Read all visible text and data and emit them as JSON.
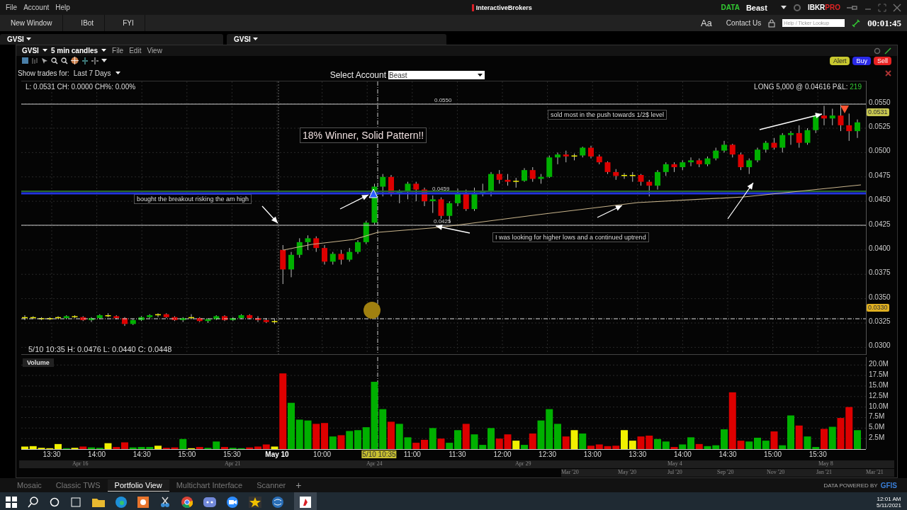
{
  "menu_bar": {
    "items": [
      "File",
      "Account",
      "Help"
    ],
    "logo": "InteractiveBrokers",
    "data_label": "DATA",
    "account": "Beast",
    "brand": "IBKR",
    "brand_suffix": "PRO"
  },
  "toolbar": {
    "buttons": [
      "New Window",
      "IBot",
      "FYI"
    ],
    "font_button": "Aa",
    "contact": "Contact Us",
    "search": {
      "placeholder": "Help / Ticker Lookup"
    },
    "clock": "00:01:45"
  },
  "panels": [
    {
      "title": "GVSI"
    },
    {
      "title": "GVSI"
    }
  ],
  "chart_window": {
    "symbol": "GVSI",
    "interval": "5 min candles",
    "menus": [
      "File",
      "Edit",
      "View"
    ],
    "trades_label": "Show trades for:",
    "trades_period": "Last 7 Days",
    "account_label": "Select Account",
    "account_value": "Beast",
    "order_buttons": [
      {
        "label": "Alert",
        "kind": "alert"
      },
      {
        "label": "Buy",
        "kind": "buy"
      },
      {
        "label": "Sell",
        "kind": "sell"
      }
    ],
    "stats": "L: 0.0531 CH: 0.0000 CH%: 0.00%",
    "position": "LONG 5,000 @ 0.04616 P&L:",
    "pnl": "219",
    "price_tags": [
      {
        "text": "0.0531",
        "kind": "last"
      },
      {
        "text": "0.0330",
        "kind": "cursor"
      }
    ],
    "line_labels": [
      "0.0550",
      "0.0459",
      "0.0425"
    ],
    "annotations": [
      {
        "text": "18% Winner, Solid Pattern!!",
        "kind": "headline"
      },
      {
        "text": "sold most in the push towards 1/2$ level",
        "kind": "note"
      },
      {
        "text": "bought the breakout risking the am high",
        "kind": "note"
      },
      {
        "text": "I was looking for higher lows and a continued uptrend",
        "kind": "note"
      }
    ],
    "hover": "5/10 10:35 H: 0.0476 L: 0.0440 C: 0.0448",
    "chart_data": {
      "type": "candlestick",
      "ylim": [
        0.0293,
        0.0573
      ],
      "grid": true,
      "yticks": [
        {
          "value": 0.055,
          "label": "0.0550"
        },
        {
          "value": 0.0525,
          "label": "0.0525"
        },
        {
          "value": 0.05,
          "label": "0.0500"
        },
        {
          "value": 0.0475,
          "label": "0.0475"
        },
        {
          "value": 0.045,
          "label": "0.0450"
        },
        {
          "value": 0.0425,
          "label": "0.0425"
        },
        {
          "value": 0.04,
          "label": "0.0400"
        },
        {
          "value": 0.0375,
          "label": "0.0375"
        },
        {
          "value": 0.035,
          "label": "0.0350"
        },
        {
          "value": 0.0325,
          "label": "0.0325"
        },
        {
          "value": 0.03,
          "label": "0.0300"
        }
      ],
      "ohlc": [
        [
          0.033,
          0.0333,
          0.0328,
          0.0331
        ],
        [
          0.0331,
          0.0332,
          0.0329,
          0.033
        ],
        [
          0.033,
          0.0331,
          0.0328,
          0.0329
        ],
        [
          0.0329,
          0.0331,
          0.0328,
          0.033
        ],
        [
          0.033,
          0.0332,
          0.0329,
          0.0331
        ],
        [
          0.033,
          0.0333,
          0.0329,
          0.0332
        ],
        [
          0.0332,
          0.0333,
          0.033,
          0.0331
        ],
        [
          0.0331,
          0.0332,
          0.0327,
          0.0328
        ],
        [
          0.0328,
          0.0331,
          0.0326,
          0.033
        ],
        [
          0.033,
          0.0334,
          0.0329,
          0.0333
        ],
        [
          0.0333,
          0.0335,
          0.0331,
          0.0332
        ],
        [
          0.0332,
          0.0333,
          0.0329,
          0.033
        ],
        [
          0.033,
          0.0331,
          0.0322,
          0.0324
        ],
        [
          0.0324,
          0.0329,
          0.0323,
          0.0328
        ],
        [
          0.0328,
          0.0332,
          0.0327,
          0.0331
        ],
        [
          0.0331,
          0.0334,
          0.033,
          0.0333
        ],
        [
          0.0333,
          0.0335,
          0.0331,
          0.0334
        ],
        [
          0.0334,
          0.0335,
          0.033,
          0.0331
        ],
        [
          0.0331,
          0.0332,
          0.0327,
          0.0328
        ],
        [
          0.0328,
          0.0331,
          0.0326,
          0.033
        ],
        [
          0.033,
          0.0334,
          0.0329,
          0.0331
        ],
        [
          0.033,
          0.0331,
          0.0326,
          0.0327
        ],
        [
          0.0327,
          0.033,
          0.0325,
          0.0329
        ],
        [
          0.0329,
          0.0333,
          0.0328,
          0.0332
        ],
        [
          0.0332,
          0.0333,
          0.0327,
          0.0328
        ],
        [
          0.0328,
          0.0331,
          0.0327,
          0.033
        ],
        [
          0.033,
          0.0334,
          0.0329,
          0.0333
        ],
        [
          0.0333,
          0.0334,
          0.0329,
          0.033
        ],
        [
          0.033,
          0.0332,
          0.0326,
          0.0328
        ],
        [
          0.0328,
          0.033,
          0.0325,
          0.0326
        ],
        [
          0.0326,
          0.0329,
          0.0324,
          0.0327
        ],
        [
          0.04,
          0.0405,
          0.0365,
          0.038
        ],
        [
          0.038,
          0.0398,
          0.0372,
          0.0395
        ],
        [
          0.0395,
          0.0412,
          0.0392,
          0.0408
        ],
        [
          0.0408,
          0.0415,
          0.04,
          0.0412
        ],
        [
          0.0412,
          0.0414,
          0.0398,
          0.0402
        ],
        [
          0.0402,
          0.0405,
          0.0385,
          0.0388
        ],
        [
          0.0388,
          0.0398,
          0.0385,
          0.0396
        ],
        [
          0.0396,
          0.04,
          0.0385,
          0.039
        ],
        [
          0.039,
          0.0402,
          0.0388,
          0.0398
        ],
        [
          0.0398,
          0.041,
          0.0396,
          0.0408
        ],
        [
          0.0408,
          0.043,
          0.0406,
          0.0428
        ],
        [
          0.0428,
          0.0468,
          0.0426,
          0.0465
        ],
        [
          0.0465,
          0.0478,
          0.0455,
          0.0475
        ],
        [
          0.0475,
          0.0477,
          0.0455,
          0.0458
        ],
        [
          0.0458,
          0.0462,
          0.0448,
          0.046
        ],
        [
          0.046,
          0.047,
          0.0452,
          0.0468
        ],
        [
          0.0468,
          0.047,
          0.045,
          0.0462
        ],
        [
          0.0462,
          0.0464,
          0.0445,
          0.045
        ],
        [
          0.045,
          0.0456,
          0.0438,
          0.0452
        ],
        [
          0.0452,
          0.0454,
          0.0432,
          0.0435
        ],
        [
          0.0435,
          0.045,
          0.0428,
          0.0448
        ],
        [
          0.0448,
          0.0463,
          0.0445,
          0.0458
        ],
        [
          0.0458,
          0.0462,
          0.044,
          0.0442
        ],
        [
          0.0442,
          0.0464,
          0.044,
          0.0458
        ],
        [
          0.0458,
          0.0468,
          0.0455,
          0.046
        ],
        [
          0.046,
          0.048,
          0.0455,
          0.0478
        ],
        [
          0.0478,
          0.0482,
          0.0468,
          0.0472
        ],
        [
          0.0472,
          0.0478,
          0.0466,
          0.047
        ],
        [
          0.047,
          0.0474,
          0.0464,
          0.0471
        ],
        [
          0.0471,
          0.0484,
          0.047,
          0.0482
        ],
        [
          0.0482,
          0.0485,
          0.047,
          0.0473
        ],
        [
          0.0473,
          0.0478,
          0.0468,
          0.0475
        ],
        [
          0.0475,
          0.0497,
          0.0474,
          0.0495
        ],
        [
          0.0495,
          0.05,
          0.0488,
          0.0498
        ],
        [
          0.0498,
          0.0502,
          0.049,
          0.0496
        ],
        [
          0.0496,
          0.0499,
          0.0492,
          0.0497
        ],
        [
          0.0497,
          0.0506,
          0.0495,
          0.0505
        ],
        [
          0.0505,
          0.0507,
          0.0494,
          0.0496
        ],
        [
          0.0496,
          0.0498,
          0.0488,
          0.049
        ],
        [
          0.049,
          0.0491,
          0.0478,
          0.048
        ],
        [
          0.048,
          0.0483,
          0.0472,
          0.0476
        ],
        [
          0.0476,
          0.0479,
          0.0473,
          0.0477
        ],
        [
          0.0476,
          0.048,
          0.047,
          0.0477
        ],
        [
          0.0477,
          0.0478,
          0.0466,
          0.047
        ],
        [
          0.047,
          0.0472,
          0.0455,
          0.0466
        ],
        [
          0.0466,
          0.0482,
          0.0462,
          0.048
        ],
        [
          0.048,
          0.049,
          0.0476,
          0.0488
        ],
        [
          0.0488,
          0.049,
          0.048,
          0.0485
        ],
        [
          0.0485,
          0.0492,
          0.0482,
          0.049
        ],
        [
          0.049,
          0.0495,
          0.0486,
          0.0492
        ],
        [
          0.0492,
          0.0494,
          0.0485,
          0.0488
        ],
        [
          0.0488,
          0.0496,
          0.0486,
          0.0494
        ],
        [
          0.0494,
          0.0505,
          0.0492,
          0.0502
        ],
        [
          0.0502,
          0.0512,
          0.05,
          0.0508
        ],
        [
          0.0508,
          0.0509,
          0.0495,
          0.0498
        ],
        [
          0.0498,
          0.05,
          0.0482,
          0.0485
        ],
        [
          0.0485,
          0.0494,
          0.0478,
          0.0492
        ],
        [
          0.0492,
          0.0505,
          0.049,
          0.0503
        ],
        [
          0.0503,
          0.0512,
          0.05,
          0.051
        ],
        [
          0.051,
          0.0515,
          0.0503,
          0.0505
        ],
        [
          0.0505,
          0.052,
          0.05,
          0.0518
        ],
        [
          0.0518,
          0.0522,
          0.0508,
          0.052
        ],
        [
          0.052,
          0.0528,
          0.0505,
          0.051
        ],
        [
          0.051,
          0.0525,
          0.0508,
          0.0523
        ],
        [
          0.0523,
          0.054,
          0.052,
          0.0538
        ],
        [
          0.0538,
          0.0548,
          0.0528,
          0.0535
        ],
        [
          0.0535,
          0.0545,
          0.0528,
          0.0538
        ],
        [
          0.0538,
          0.0549,
          0.0522,
          0.0528
        ],
        [
          0.0528,
          0.054,
          0.0512,
          0.0522
        ],
        [
          0.0522,
          0.0534,
          0.0515,
          0.0531
        ]
      ]
    },
    "volume_chart": {
      "chart_data": {
        "type": "bar",
        "ylabel": "Volume",
        "ylim": [
          0,
          21.9
        ],
        "grid": true,
        "yticks": [
          {
            "value": 20,
            "label": "20.0M"
          },
          {
            "value": 17.5,
            "label": "17.5M"
          },
          {
            "value": 15,
            "label": "15.0M"
          },
          {
            "value": 12.5,
            "label": "12.5M"
          },
          {
            "value": 10,
            "label": "10.0M"
          },
          {
            "value": 7.5,
            "label": "7.5M"
          },
          {
            "value": 5,
            "label": "5.0M"
          },
          {
            "value": 2.5,
            "label": "2.5M"
          }
        ],
        "values": [
          0.6,
          0.7,
          0.3,
          0.2,
          1.2,
          0.2,
          0.3,
          0.6,
          0.4,
          0.3,
          1.4,
          0.5,
          1.6,
          0.4,
          0.5,
          0.5,
          0.8,
          0.3,
          0.4,
          2.4,
          0.2,
          0.5,
          0.3,
          1.8,
          0.5,
          0.3,
          0.2,
          0.4,
          0.6,
          1.1,
          0.6,
          18.0,
          11.0,
          7.0,
          6.8,
          6.0,
          6.2,
          3.0,
          3.3,
          4.3,
          4.5,
          5.2,
          16.0,
          9.5,
          6.5,
          6.0,
          2.8,
          1.5,
          2.2,
          5.0,
          2.5,
          1.5,
          4.5,
          6.0,
          3.5,
          1.0,
          5.0,
          2.5,
          3.5,
          2.0,
          1.0,
          3.7,
          6.8,
          9.5,
          6.0,
          3.0,
          4.5,
          3.7,
          0.8,
          1.1,
          0.7,
          0.8,
          4.5,
          2.0,
          3.0,
          3.2,
          2.4,
          1.8,
          0.5,
          1.1,
          2.8,
          1.2,
          0.7,
          0.9,
          4.7,
          13.5,
          2.0,
          1.8,
          2.7,
          2.0,
          4.2,
          0.9,
          8.0,
          5.6,
          3.0,
          0.5,
          4.8,
          5.3,
          7.4,
          10.0,
          4.5
        ]
      }
    },
    "time_axis": [
      {
        "text": "13:30",
        "kind": "tick"
      },
      {
        "text": "14:00",
        "kind": "tick"
      },
      {
        "text": "14:30",
        "kind": "tick"
      },
      {
        "text": "15:00",
        "kind": "tick"
      },
      {
        "text": "15:30",
        "kind": "tick"
      },
      {
        "text": "May 10",
        "kind": "day"
      },
      {
        "text": "10:00",
        "kind": "tick"
      },
      {
        "text": "5/10 10:35",
        "kind": "cursor"
      },
      {
        "text": "11:00",
        "kind": "tick"
      },
      {
        "text": "11:30",
        "kind": "tick"
      },
      {
        "text": "12:00",
        "kind": "tick"
      },
      {
        "text": "12:30",
        "kind": "tick"
      },
      {
        "text": "13:00",
        "kind": "tick"
      },
      {
        "text": "13:30",
        "kind": "tick"
      },
      {
        "text": "14:00",
        "kind": "tick"
      },
      {
        "text": "14:30",
        "kind": "tick"
      },
      {
        "text": "15:00",
        "kind": "tick"
      },
      {
        "text": "15:30",
        "kind": "tick"
      }
    ],
    "scroll_dates": [
      "Apr 16",
      "Apr 21",
      "Apr 24",
      "Apr 29",
      "May 4",
      "May 8"
    ],
    "range_dates": [
      "Mar '20",
      "May '20",
      "Jul '20",
      "Sep '20",
      "Nov '20",
      "Jan '21",
      "Mar '21"
    ]
  },
  "workspace_tabs": [
    {
      "label": "Mosaic",
      "selected": false
    },
    {
      "label": "Classic TWS",
      "selected": false
    },
    {
      "label": "Portfolio View",
      "selected": true
    },
    {
      "label": "Multichart Interface",
      "selected": false
    },
    {
      "label": "Scanner",
      "selected": false
    }
  ],
  "add_tab": "+",
  "data_credit": "DATA POWERED BY",
  "data_vendor": "GFIS",
  "taskbar": {
    "time": "12:01 AM",
    "date": "5/11/2021"
  }
}
